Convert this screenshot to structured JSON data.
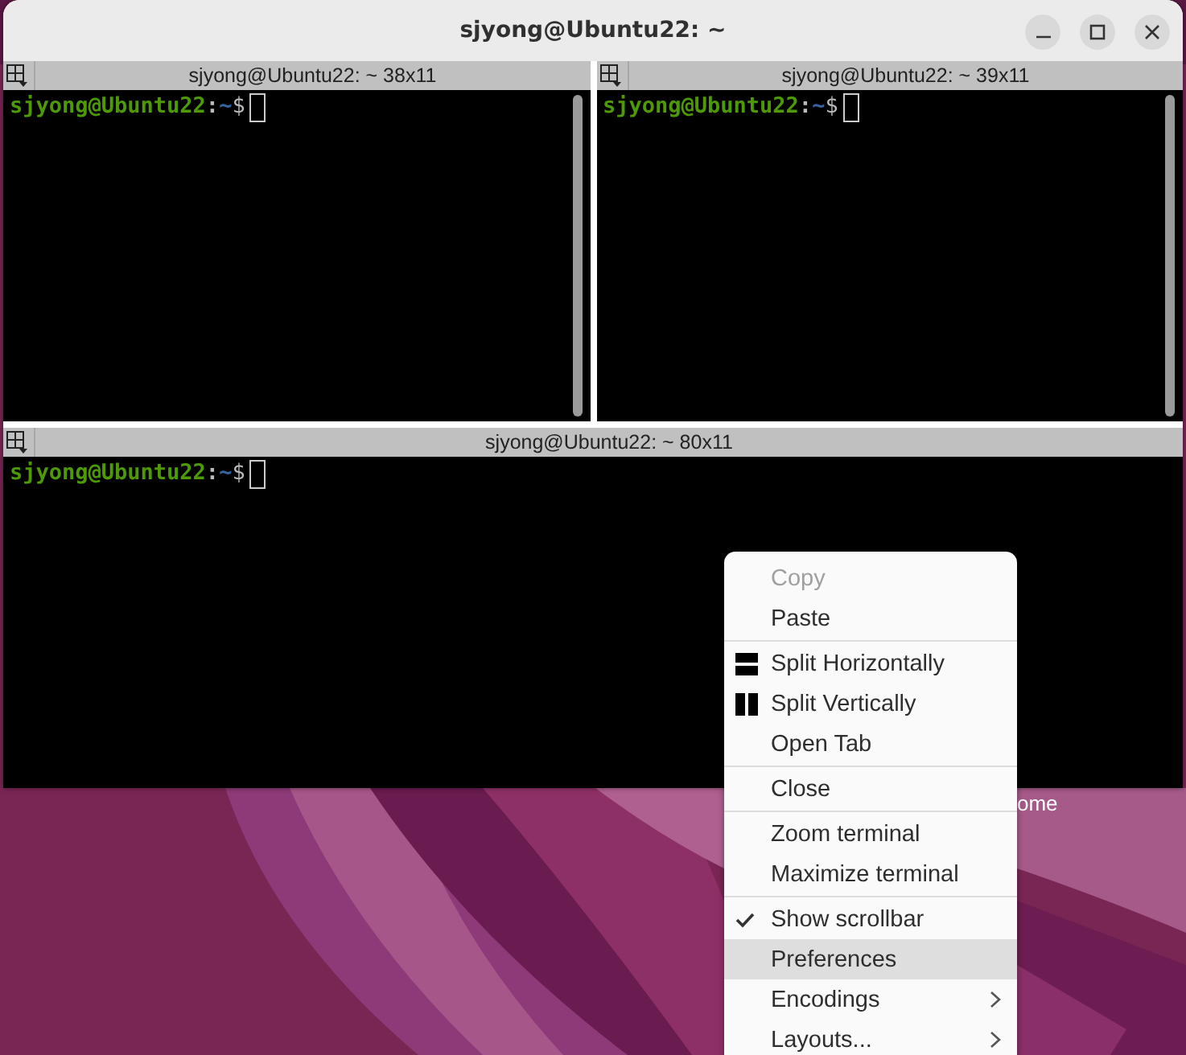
{
  "window": {
    "title": "sjyong@Ubuntu22: ~"
  },
  "panes": [
    {
      "title": "sjyong@Ubuntu22: ~ 38x11",
      "user": "sjyong@Ubuntu22",
      "separator": ":",
      "path": "~",
      "symbol": "$",
      "scrollbar": true
    },
    {
      "title": "sjyong@Ubuntu22: ~ 39x11",
      "user": "sjyong@Ubuntu22",
      "separator": ":",
      "path": "~",
      "symbol": "$",
      "scrollbar": true
    },
    {
      "title": "sjyong@Ubuntu22: ~ 80x11",
      "user": "sjyong@Ubuntu22",
      "separator": ":",
      "path": "~",
      "symbol": "$",
      "scrollbar": false
    }
  ],
  "desktop_label": "ome",
  "context_menu": {
    "groups": [
      [
        {
          "label": "Copy",
          "kind": "plain",
          "disabled": true,
          "selected": false
        },
        {
          "label": "Paste",
          "kind": "plain",
          "disabled": false,
          "selected": false
        }
      ],
      [
        {
          "label": "Split Horizontally",
          "kind": "split-horizontal",
          "disabled": false,
          "selected": false
        },
        {
          "label": "Split Vertically",
          "kind": "split-vertical",
          "disabled": false,
          "selected": false
        },
        {
          "label": "Open Tab",
          "kind": "plain",
          "disabled": false,
          "selected": false
        }
      ],
      [
        {
          "label": "Close",
          "kind": "plain",
          "disabled": false,
          "selected": false
        }
      ],
      [
        {
          "label": "Zoom terminal",
          "kind": "plain",
          "disabled": false,
          "selected": false
        },
        {
          "label": "Maximize terminal",
          "kind": "plain",
          "disabled": false,
          "selected": false
        }
      ],
      [
        {
          "label": "Show scrollbar",
          "kind": "check",
          "checked": true,
          "disabled": false,
          "selected": false
        },
        {
          "label": "Preferences",
          "kind": "plain",
          "disabled": false,
          "selected": true
        },
        {
          "label": "Encodings",
          "kind": "submenu",
          "disabled": false,
          "selected": false
        },
        {
          "label": "Layouts...",
          "kind": "submenu",
          "disabled": false,
          "selected": false
        }
      ]
    ]
  }
}
